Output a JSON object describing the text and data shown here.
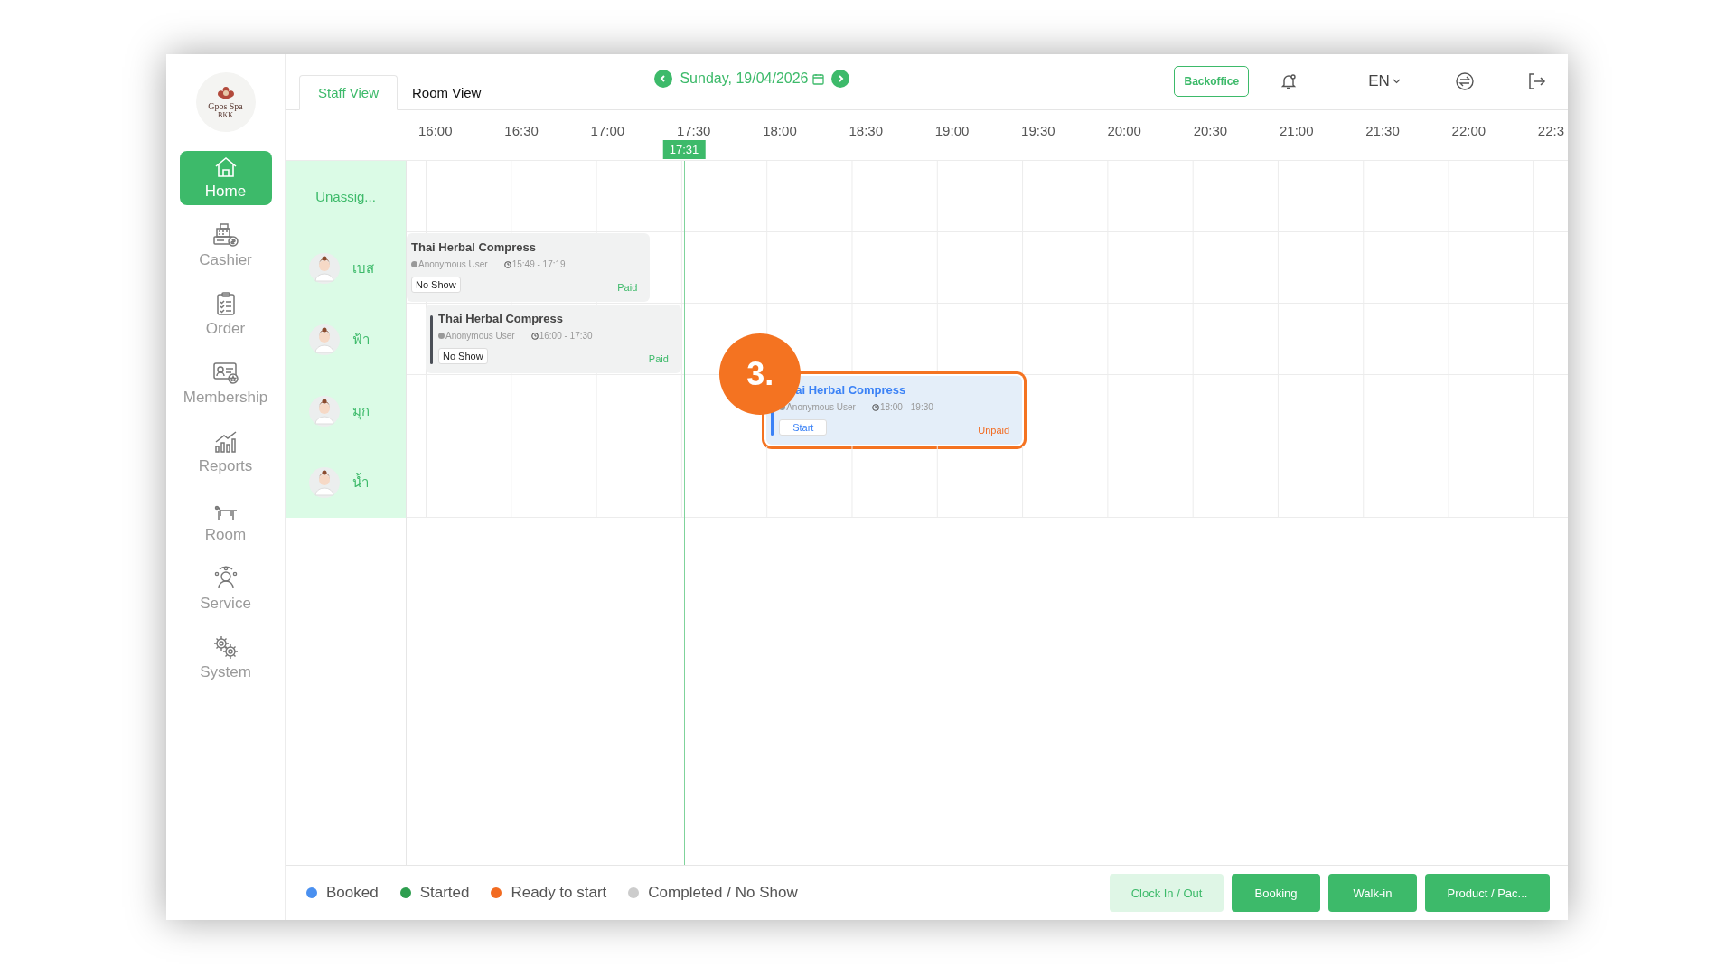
{
  "logo": {
    "name": "Gpos Spa",
    "sub": "BKK"
  },
  "sidebar": {
    "items": [
      {
        "label": "Home",
        "selected": true
      },
      {
        "label": "Cashier",
        "selected": false
      },
      {
        "label": "Order",
        "selected": false
      },
      {
        "label": "Membership",
        "selected": false
      },
      {
        "label": "Reports",
        "selected": false
      },
      {
        "label": "Room",
        "selected": false
      },
      {
        "label": "Service",
        "selected": false
      },
      {
        "label": "System",
        "selected": false
      }
    ]
  },
  "tabs": [
    {
      "label": "Staff View",
      "selected": true
    },
    {
      "label": "Room View",
      "selected": false
    }
  ],
  "date": "Sunday, 19/04/2026",
  "header_actions": {
    "backoffice": "Backoffice",
    "language": "EN"
  },
  "time_slots": [
    "16:00",
    "16:30",
    "17:00",
    "17:30",
    "18:00",
    "18:30",
    "19:00",
    "19:30",
    "20:00",
    "20:30",
    "21:00",
    "21:30",
    "22:00",
    "22:3"
  ],
  "now": "17:31",
  "staff": [
    {
      "name": "Unassig...",
      "kind": "group"
    },
    {
      "name": "เบส",
      "kind": "staff",
      "bookings": [
        {
          "title": "Thai Herbal Compress",
          "customer": "Anonymous User",
          "time": "15:49 - 17:19",
          "kind": "no_show",
          "action": "No Show",
          "payment": "Paid",
          "paid": true
        }
      ]
    },
    {
      "name": "ฟ้า",
      "kind": "staff",
      "bookings": [
        {
          "title": "Thai Herbal Compress",
          "customer": "Anonymous User",
          "time": "16:00 - 17:30",
          "kind": "no_show",
          "action": "No Show",
          "payment": "Paid",
          "paid": true,
          "color": "#4b4f57"
        }
      ]
    },
    {
      "name": "มุก",
      "kind": "staff",
      "bookings": [
        {
          "title": "ai Herbal Compress",
          "customer": "Anonymous User",
          "time": "18:00 - 19:30",
          "kind": "booked",
          "action": "Start",
          "payment": "Unpaid",
          "paid": false,
          "color": "#3b82f6",
          "annotation": "3."
        }
      ]
    },
    {
      "name": "น้ำ",
      "kind": "staff"
    }
  ],
  "legend": [
    {
      "label": "Booked",
      "color": "#4a90f0"
    },
    {
      "label": "Started",
      "color": "#2e9e4f"
    },
    {
      "label": "Ready to start",
      "color": "#f26b21"
    },
    {
      "label": "Completed / No Show",
      "color": "#cccccc"
    }
  ],
  "footer_buttons": [
    {
      "label": "Clock In / Out",
      "kind": "secondary"
    },
    {
      "label": "Booking",
      "kind": "primary"
    },
    {
      "label": "Walk-in",
      "kind": "primary"
    },
    {
      "label": "Product / Pac...",
      "kind": "primary"
    }
  ]
}
